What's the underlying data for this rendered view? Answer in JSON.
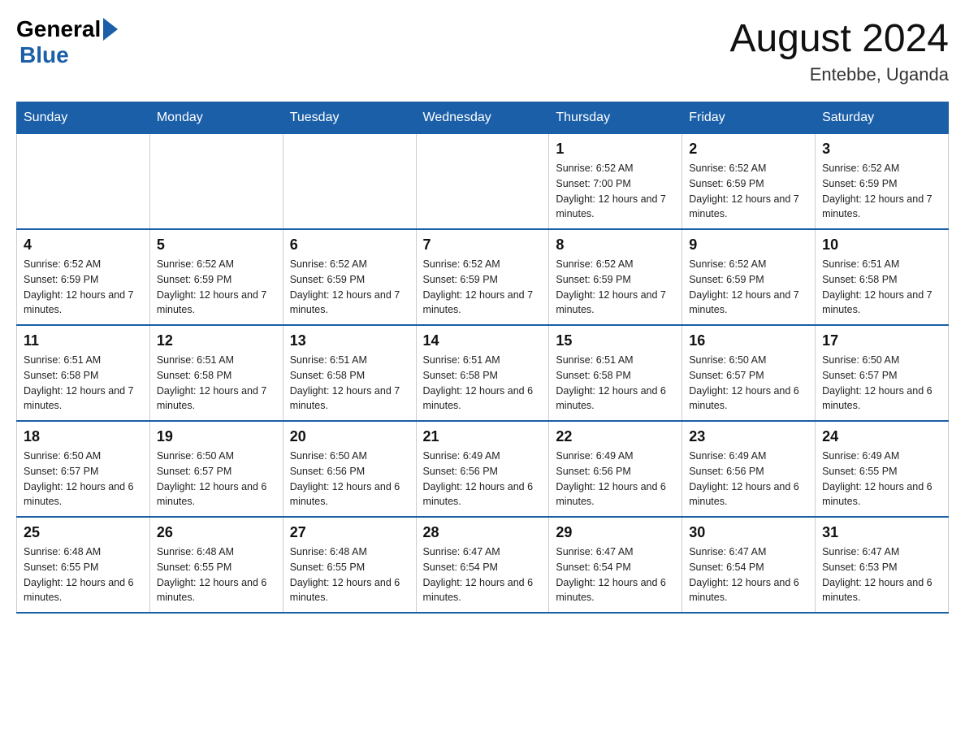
{
  "header": {
    "logo_general": "General",
    "logo_blue": "Blue",
    "title": "August 2024",
    "subtitle": "Entebbe, Uganda"
  },
  "weekdays": [
    "Sunday",
    "Monday",
    "Tuesday",
    "Wednesday",
    "Thursday",
    "Friday",
    "Saturday"
  ],
  "weeks": [
    [
      {
        "day": "",
        "info": ""
      },
      {
        "day": "",
        "info": ""
      },
      {
        "day": "",
        "info": ""
      },
      {
        "day": "",
        "info": ""
      },
      {
        "day": "1",
        "info": "Sunrise: 6:52 AM\nSunset: 7:00 PM\nDaylight: 12 hours and 7 minutes."
      },
      {
        "day": "2",
        "info": "Sunrise: 6:52 AM\nSunset: 6:59 PM\nDaylight: 12 hours and 7 minutes."
      },
      {
        "day": "3",
        "info": "Sunrise: 6:52 AM\nSunset: 6:59 PM\nDaylight: 12 hours and 7 minutes."
      }
    ],
    [
      {
        "day": "4",
        "info": "Sunrise: 6:52 AM\nSunset: 6:59 PM\nDaylight: 12 hours and 7 minutes."
      },
      {
        "day": "5",
        "info": "Sunrise: 6:52 AM\nSunset: 6:59 PM\nDaylight: 12 hours and 7 minutes."
      },
      {
        "day": "6",
        "info": "Sunrise: 6:52 AM\nSunset: 6:59 PM\nDaylight: 12 hours and 7 minutes."
      },
      {
        "day": "7",
        "info": "Sunrise: 6:52 AM\nSunset: 6:59 PM\nDaylight: 12 hours and 7 minutes."
      },
      {
        "day": "8",
        "info": "Sunrise: 6:52 AM\nSunset: 6:59 PM\nDaylight: 12 hours and 7 minutes."
      },
      {
        "day": "9",
        "info": "Sunrise: 6:52 AM\nSunset: 6:59 PM\nDaylight: 12 hours and 7 minutes."
      },
      {
        "day": "10",
        "info": "Sunrise: 6:51 AM\nSunset: 6:58 PM\nDaylight: 12 hours and 7 minutes."
      }
    ],
    [
      {
        "day": "11",
        "info": "Sunrise: 6:51 AM\nSunset: 6:58 PM\nDaylight: 12 hours and 7 minutes."
      },
      {
        "day": "12",
        "info": "Sunrise: 6:51 AM\nSunset: 6:58 PM\nDaylight: 12 hours and 7 minutes."
      },
      {
        "day": "13",
        "info": "Sunrise: 6:51 AM\nSunset: 6:58 PM\nDaylight: 12 hours and 7 minutes."
      },
      {
        "day": "14",
        "info": "Sunrise: 6:51 AM\nSunset: 6:58 PM\nDaylight: 12 hours and 6 minutes."
      },
      {
        "day": "15",
        "info": "Sunrise: 6:51 AM\nSunset: 6:58 PM\nDaylight: 12 hours and 6 minutes."
      },
      {
        "day": "16",
        "info": "Sunrise: 6:50 AM\nSunset: 6:57 PM\nDaylight: 12 hours and 6 minutes."
      },
      {
        "day": "17",
        "info": "Sunrise: 6:50 AM\nSunset: 6:57 PM\nDaylight: 12 hours and 6 minutes."
      }
    ],
    [
      {
        "day": "18",
        "info": "Sunrise: 6:50 AM\nSunset: 6:57 PM\nDaylight: 12 hours and 6 minutes."
      },
      {
        "day": "19",
        "info": "Sunrise: 6:50 AM\nSunset: 6:57 PM\nDaylight: 12 hours and 6 minutes."
      },
      {
        "day": "20",
        "info": "Sunrise: 6:50 AM\nSunset: 6:56 PM\nDaylight: 12 hours and 6 minutes."
      },
      {
        "day": "21",
        "info": "Sunrise: 6:49 AM\nSunset: 6:56 PM\nDaylight: 12 hours and 6 minutes."
      },
      {
        "day": "22",
        "info": "Sunrise: 6:49 AM\nSunset: 6:56 PM\nDaylight: 12 hours and 6 minutes."
      },
      {
        "day": "23",
        "info": "Sunrise: 6:49 AM\nSunset: 6:56 PM\nDaylight: 12 hours and 6 minutes."
      },
      {
        "day": "24",
        "info": "Sunrise: 6:49 AM\nSunset: 6:55 PM\nDaylight: 12 hours and 6 minutes."
      }
    ],
    [
      {
        "day": "25",
        "info": "Sunrise: 6:48 AM\nSunset: 6:55 PM\nDaylight: 12 hours and 6 minutes."
      },
      {
        "day": "26",
        "info": "Sunrise: 6:48 AM\nSunset: 6:55 PM\nDaylight: 12 hours and 6 minutes."
      },
      {
        "day": "27",
        "info": "Sunrise: 6:48 AM\nSunset: 6:55 PM\nDaylight: 12 hours and 6 minutes."
      },
      {
        "day": "28",
        "info": "Sunrise: 6:47 AM\nSunset: 6:54 PM\nDaylight: 12 hours and 6 minutes."
      },
      {
        "day": "29",
        "info": "Sunrise: 6:47 AM\nSunset: 6:54 PM\nDaylight: 12 hours and 6 minutes."
      },
      {
        "day": "30",
        "info": "Sunrise: 6:47 AM\nSunset: 6:54 PM\nDaylight: 12 hours and 6 minutes."
      },
      {
        "day": "31",
        "info": "Sunrise: 6:47 AM\nSunset: 6:53 PM\nDaylight: 12 hours and 6 minutes."
      }
    ]
  ]
}
